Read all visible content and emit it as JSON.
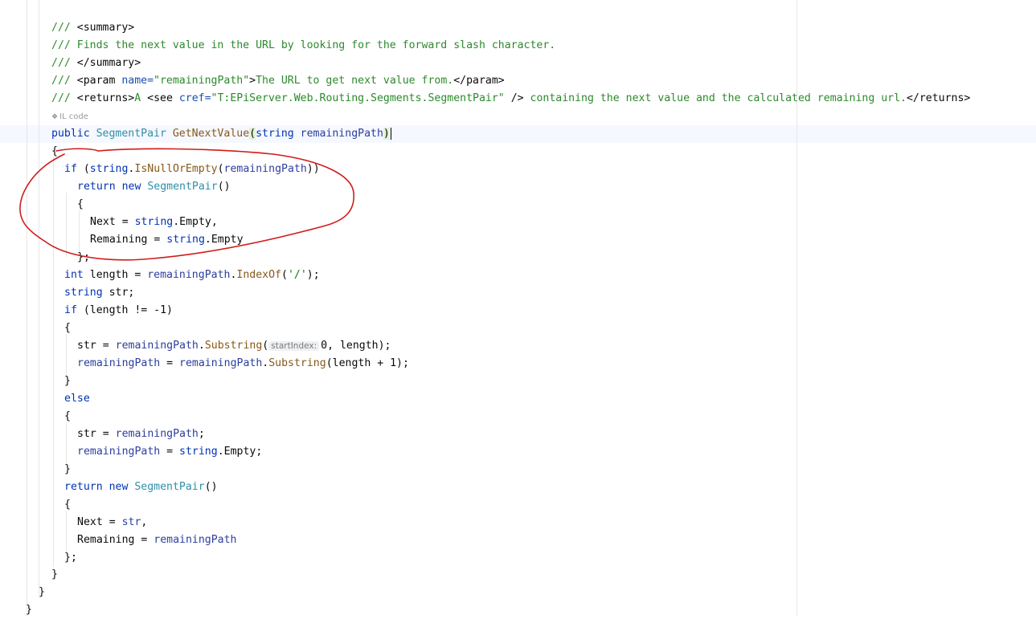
{
  "editor": {
    "lines": [
      {
        "tokens": [
          {
            "t": "/// ",
            "c": "c"
          },
          {
            "t": "<summary>",
            "c": "tg"
          }
        ]
      },
      {
        "tokens": [
          {
            "t": "/// Finds the next value in the URL by looking for the forward slash character.",
            "c": "c"
          }
        ]
      },
      {
        "tokens": [
          {
            "t": "/// ",
            "c": "c"
          },
          {
            "t": "</summary>",
            "c": "tg"
          }
        ]
      },
      {
        "tokens": [
          {
            "t": "/// ",
            "c": "c"
          },
          {
            "t": "<param ",
            "c": "tg"
          },
          {
            "t": "name=",
            "c": "an"
          },
          {
            "t": "\"remainingPath\"",
            "c": "av"
          },
          {
            "t": ">",
            "c": "tg"
          },
          {
            "t": "The URL to get next value from.",
            "c": "c"
          },
          {
            "t": "</param>",
            "c": "tg"
          }
        ]
      },
      {
        "tokens": [
          {
            "t": "/// ",
            "c": "c"
          },
          {
            "t": "<returns>",
            "c": "tg"
          },
          {
            "t": "A ",
            "c": "c"
          },
          {
            "t": "<see ",
            "c": "tg"
          },
          {
            "t": "cref=",
            "c": "an"
          },
          {
            "t": "\"T:EPiServer.Web.Routing.Segments.SegmentPair\"",
            "c": "av"
          },
          {
            "t": " />",
            "c": "tg"
          },
          {
            "t": " containing the next value and the calculated remaining url.",
            "c": "c"
          },
          {
            "t": "</returns>",
            "c": "tg"
          }
        ]
      },
      {
        "tokens": [
          {
            "t": "public ",
            "c": "kw"
          },
          {
            "t": "SegmentPair ",
            "c": "ty"
          },
          {
            "t": "GetNextValue",
            "c": "fn"
          },
          {
            "t": "(",
            "c": "brace-hl"
          },
          {
            "t": "string ",
            "c": "kw"
          },
          {
            "t": "remainingPath",
            "c": "pm"
          },
          {
            "t": ")",
            "c": "brace-hl"
          }
        ]
      },
      {
        "tokens": [
          {
            "t": "{",
            "c": "nm"
          }
        ]
      },
      {
        "tokens": [
          {
            "t": "if ",
            "c": "kw"
          },
          {
            "t": "(",
            "c": "nm"
          },
          {
            "t": "string",
            "c": "kw"
          },
          {
            "t": ".",
            "c": "nm"
          },
          {
            "t": "IsNullOrEmpty",
            "c": "fn"
          },
          {
            "t": "(",
            "c": "nm"
          },
          {
            "t": "remainingPath",
            "c": "pm"
          },
          {
            "t": "))",
            "c": "nm"
          }
        ]
      },
      {
        "tokens": [
          {
            "t": "return ",
            "c": "kw"
          },
          {
            "t": "new ",
            "c": "kw"
          },
          {
            "t": "SegmentPair",
            "c": "ty"
          },
          {
            "t": "()",
            "c": "nm"
          }
        ]
      },
      {
        "tokens": [
          {
            "t": "{",
            "c": "nm"
          }
        ]
      },
      {
        "tokens": [
          {
            "t": "Next = ",
            "c": "nm"
          },
          {
            "t": "string",
            "c": "kw"
          },
          {
            "t": ".Empty,",
            "c": "nm"
          }
        ]
      },
      {
        "tokens": [
          {
            "t": "Remaining = ",
            "c": "nm"
          },
          {
            "t": "string",
            "c": "kw"
          },
          {
            "t": ".Empty",
            "c": "nm"
          }
        ]
      },
      {
        "tokens": [
          {
            "t": "};",
            "c": "nm"
          }
        ]
      },
      {
        "tokens": [
          {
            "t": "int ",
            "c": "kw"
          },
          {
            "t": "length = ",
            "c": "nm"
          },
          {
            "t": "remainingPath",
            "c": "pm"
          },
          {
            "t": ".",
            "c": "nm"
          },
          {
            "t": "IndexOf",
            "c": "fn"
          },
          {
            "t": "(",
            "c": "nm"
          },
          {
            "t": "'/'",
            "c": "st"
          },
          {
            "t": ");",
            "c": "nm"
          }
        ]
      },
      {
        "tokens": [
          {
            "t": "string ",
            "c": "kw"
          },
          {
            "t": "str;",
            "c": "nm"
          }
        ]
      },
      {
        "tokens": [
          {
            "t": "if ",
            "c": "kw"
          },
          {
            "t": "(length != -1)",
            "c": "nm"
          }
        ]
      },
      {
        "tokens": [
          {
            "t": "{",
            "c": "nm"
          }
        ]
      },
      {
        "tokens": [
          {
            "t": "str = ",
            "c": "nm"
          },
          {
            "t": "remainingPath",
            "c": "pm"
          },
          {
            "t": ".",
            "c": "nm"
          },
          {
            "t": "Substring",
            "c": "fn"
          },
          {
            "t": "(",
            "c": "nm"
          },
          {
            "t": "startIndex:",
            "c": "hint"
          },
          {
            "t": "0, length);",
            "c": "nm"
          }
        ]
      },
      {
        "tokens": [
          {
            "t": "remainingPath",
            "c": "pm"
          },
          {
            "t": " = ",
            "c": "nm"
          },
          {
            "t": "remainingPath",
            "c": "pm"
          },
          {
            "t": ".",
            "c": "nm"
          },
          {
            "t": "Substring",
            "c": "fn"
          },
          {
            "t": "(length + 1);",
            "c": "nm"
          }
        ]
      },
      {
        "tokens": [
          {
            "t": "}",
            "c": "nm"
          }
        ]
      },
      {
        "tokens": [
          {
            "t": "else",
            "c": "kw"
          }
        ]
      },
      {
        "tokens": [
          {
            "t": "{",
            "c": "nm"
          }
        ]
      },
      {
        "tokens": [
          {
            "t": "str = ",
            "c": "nm"
          },
          {
            "t": "remainingPath",
            "c": "pm"
          },
          {
            "t": ";",
            "c": "nm"
          }
        ]
      },
      {
        "tokens": [
          {
            "t": "remainingPath",
            "c": "pm"
          },
          {
            "t": " = ",
            "c": "nm"
          },
          {
            "t": "string",
            "c": "kw"
          },
          {
            "t": ".Empty;",
            "c": "nm"
          }
        ]
      },
      {
        "tokens": [
          {
            "t": "}",
            "c": "nm"
          }
        ]
      },
      {
        "tokens": [
          {
            "t": "return ",
            "c": "kw"
          },
          {
            "t": "new ",
            "c": "kw"
          },
          {
            "t": "SegmentPair",
            "c": "ty"
          },
          {
            "t": "()",
            "c": "nm"
          }
        ]
      },
      {
        "tokens": [
          {
            "t": "{",
            "c": "nm"
          }
        ]
      },
      {
        "tokens": [
          {
            "t": "Next = ",
            "c": "nm"
          },
          {
            "t": "str",
            "c": "pm"
          },
          {
            "t": ",",
            "c": "nm"
          }
        ]
      },
      {
        "tokens": [
          {
            "t": "Remaining = ",
            "c": "nm"
          },
          {
            "t": "remainingPath",
            "c": "pm"
          }
        ]
      },
      {
        "tokens": [
          {
            "t": "};",
            "c": "nm"
          }
        ]
      },
      {
        "tokens": [
          {
            "t": "}",
            "c": "nm"
          }
        ]
      },
      {
        "tokens": [
          {
            "t": "}",
            "c": "nm"
          }
        ]
      },
      {
        "tokens": [
          {
            "t": "}",
            "c": "nm"
          }
        ]
      }
    ],
    "il_hint": "IL code",
    "il_hint_icon": "il-code-icon"
  }
}
